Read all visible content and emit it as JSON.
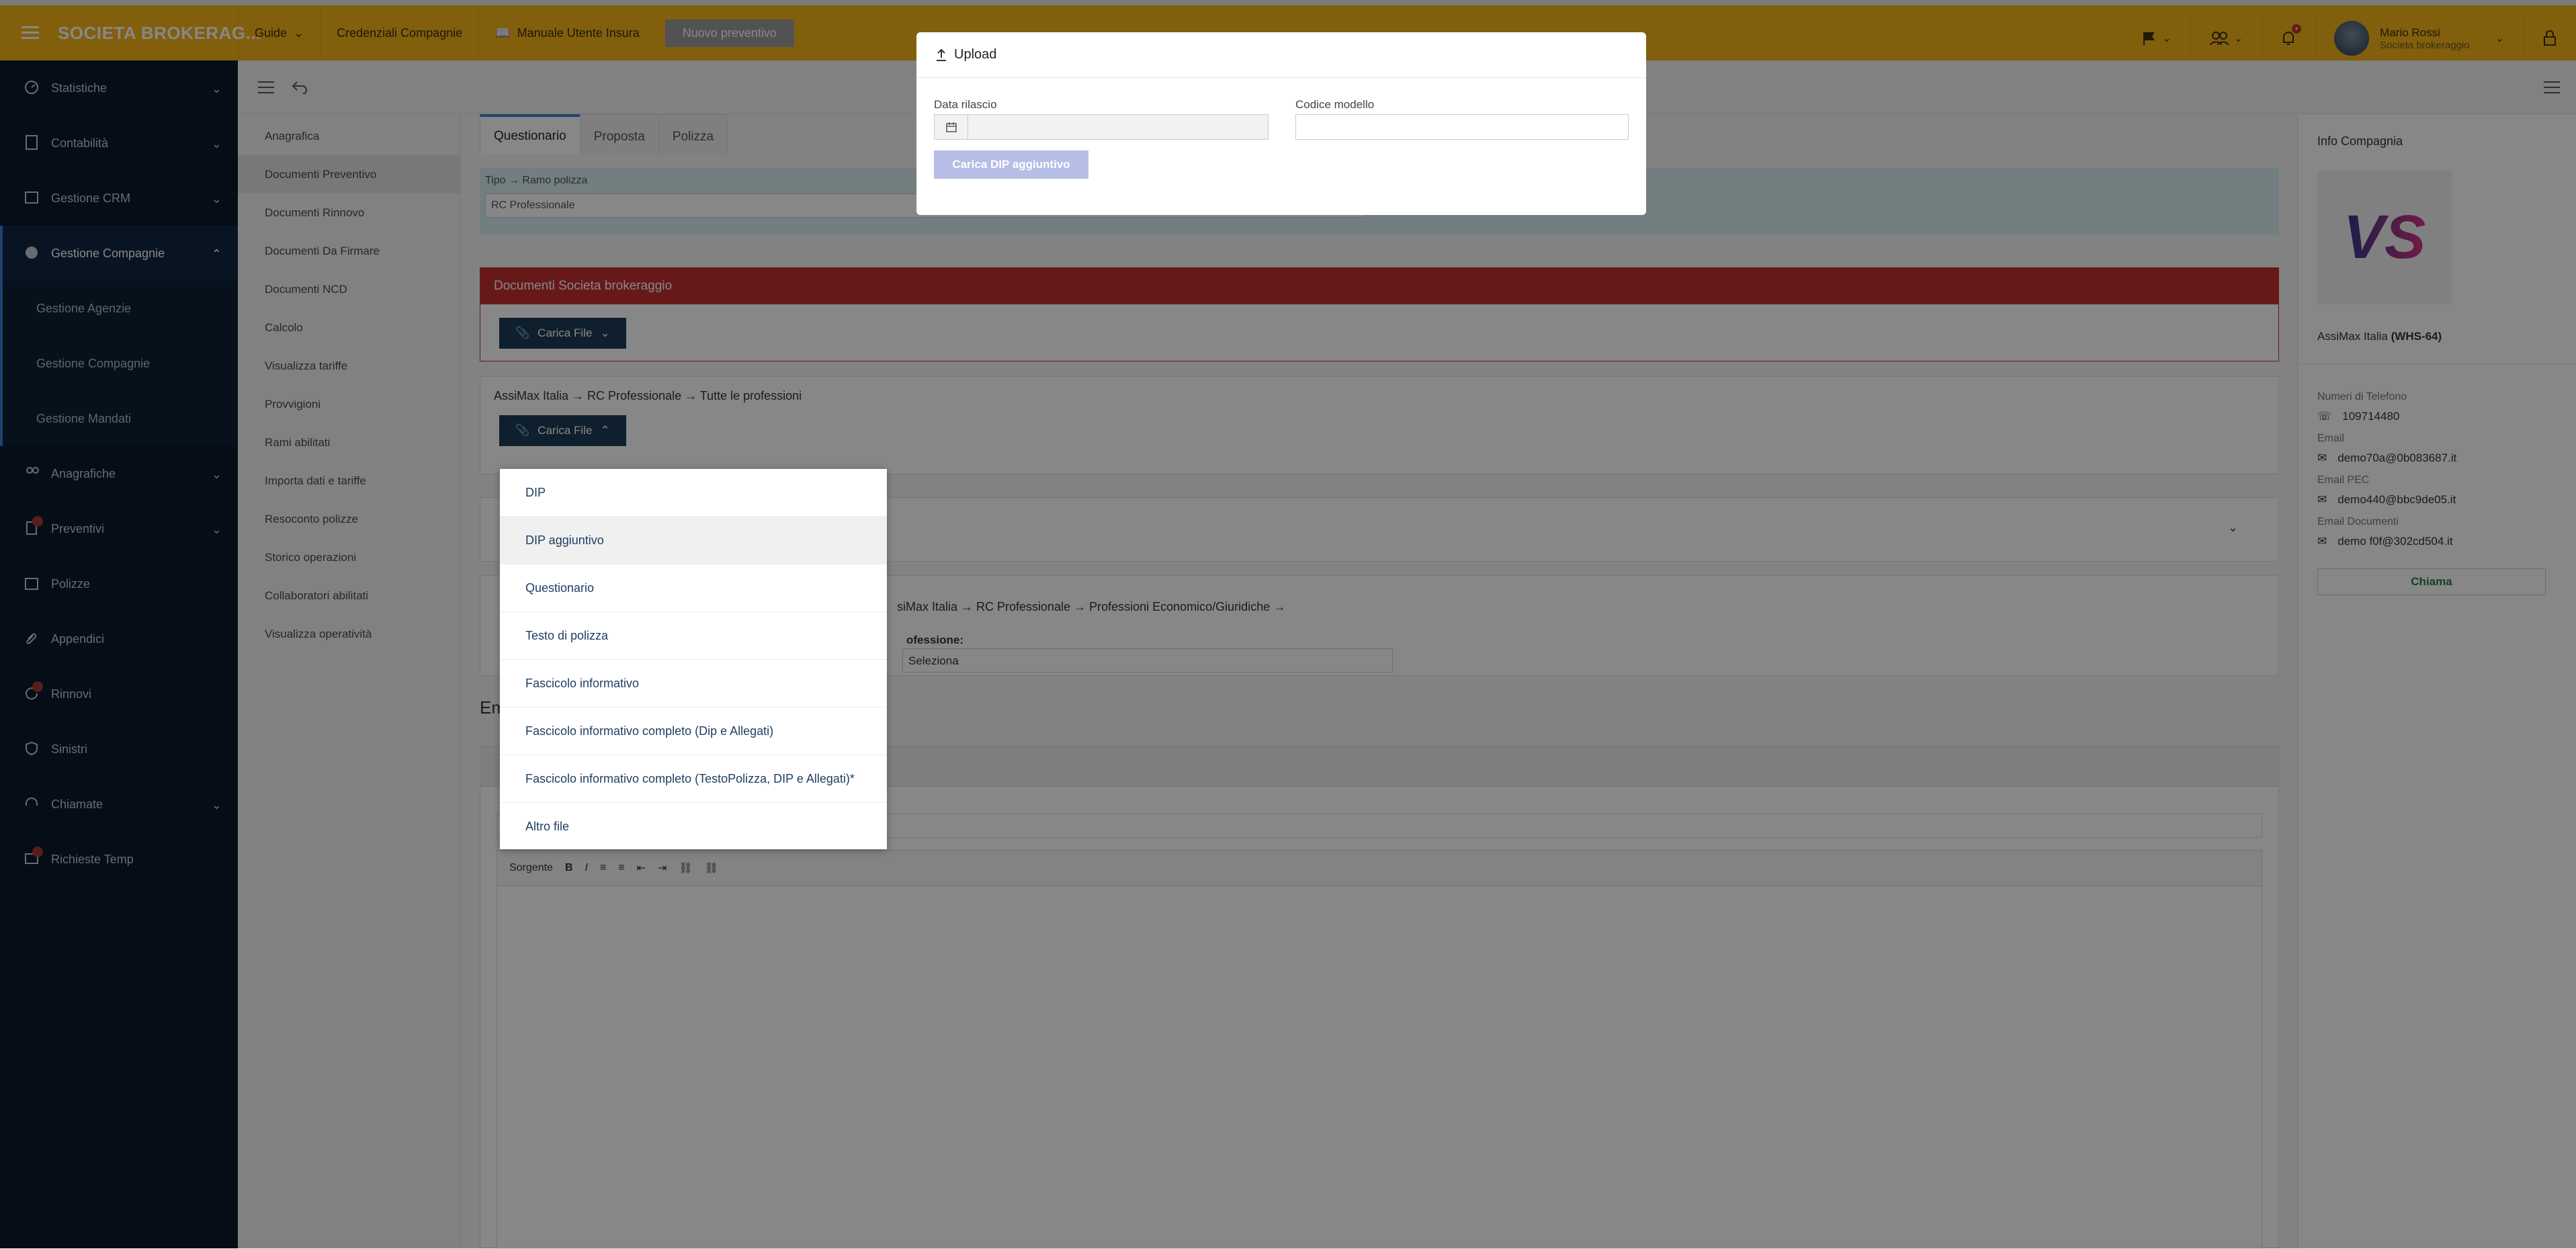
{
  "topbar": {
    "brand": "SOCIETA BROKERAG...",
    "nav": [
      "Guide",
      "Credenziali Compagnie",
      "Manuale Utente Insura"
    ],
    "new_quote_button": "Nuovo preventivo",
    "user_name": "Mario Rossi",
    "user_role": "Societa brokeraggio"
  },
  "sidebar": {
    "items": [
      {
        "label": "Statistiche",
        "icon": "gauge-icon"
      },
      {
        "label": "Contabilità",
        "icon": "calculator-icon"
      },
      {
        "label": "Gestione CRM",
        "icon": "crm-icon"
      },
      {
        "label": "Gestione Compagnie",
        "icon": "globe-icon"
      },
      {
        "label": "Anagrafiche",
        "icon": "users-icon"
      },
      {
        "label": "Preventivi",
        "icon": "file-icon"
      },
      {
        "label": "Polizze",
        "icon": "calendar-icon"
      },
      {
        "label": "Appendici",
        "icon": "paperclip-icon"
      },
      {
        "label": "Rinnovi",
        "icon": "refresh-icon"
      },
      {
        "label": "Sinistri",
        "icon": "shield-icon"
      },
      {
        "label": "Chiamate",
        "icon": "headset-icon"
      },
      {
        "label": "Richieste Temp",
        "icon": "message-icon"
      }
    ],
    "subitems": [
      "Gestione Agenzie",
      "Gestione Compagnie",
      "Gestione Mandati"
    ]
  },
  "subnav": {
    "items": [
      "Anagrafica",
      "Documenti Preventivo",
      "Documenti Rinnovo",
      "Documenti Da Firmare",
      "Documenti NCD",
      "Calcolo",
      "Visualizza tariffe",
      "Provvigioni",
      "Rami abilitati",
      "Importa dati e tariffe",
      "Resoconto polizze",
      "Storico operazioni",
      "Collaboratori abilitati",
      "Visualizza operatività"
    ]
  },
  "main": {
    "tabs": [
      "Questionario",
      "Proposta",
      "Polizza"
    ],
    "info_header": "Tipo → Ramo polizza",
    "info_value": "RC Professionale",
    "red_panel_title": "Documenti Societa brokeraggio",
    "upload_button": "Carica File",
    "breadcrumb": "AssiMax Italia → RC Professionale → Tutte le professioni",
    "breadcrumb2": "siMax Italia  →  RC Professionale  →  Professioni Economico/Giuridiche  →",
    "professione_label": "ofessione:",
    "professione_select": "Seleziona",
    "em_label": "Em",
    "editor": {
      "source": "Sorgente"
    }
  },
  "dropdown": {
    "options": [
      "DIP",
      "DIP aggiuntivo",
      "Questionario",
      "Testo di polizza",
      "Fascicolo informativo",
      "Fascicolo informativo completo (Dip e Allegati)",
      "Fascicolo informativo completo (TestoPolizza, DIP e Allegati)*",
      "Altro file"
    ]
  },
  "right": {
    "title": "Info Compagnia",
    "logo_text": "VS",
    "company": "AssiMax Italia",
    "code": "(WHS-64)",
    "phone_label": "Numeri di Telefono",
    "phone": "109714480",
    "email_label": "Email",
    "email": "demo70a@0b083687.it",
    "pec_label": "Email PEC",
    "pec": "demo440@bbc9de05.it",
    "docs_label": "Email Documenti",
    "docs": "demo f0f@302cd504.it",
    "call_button": "Chiama"
  },
  "modal": {
    "title": "Upload",
    "date_label": "Data rilascio",
    "model_label": "Codice modello",
    "button": "Carica DIP aggiuntivo"
  }
}
